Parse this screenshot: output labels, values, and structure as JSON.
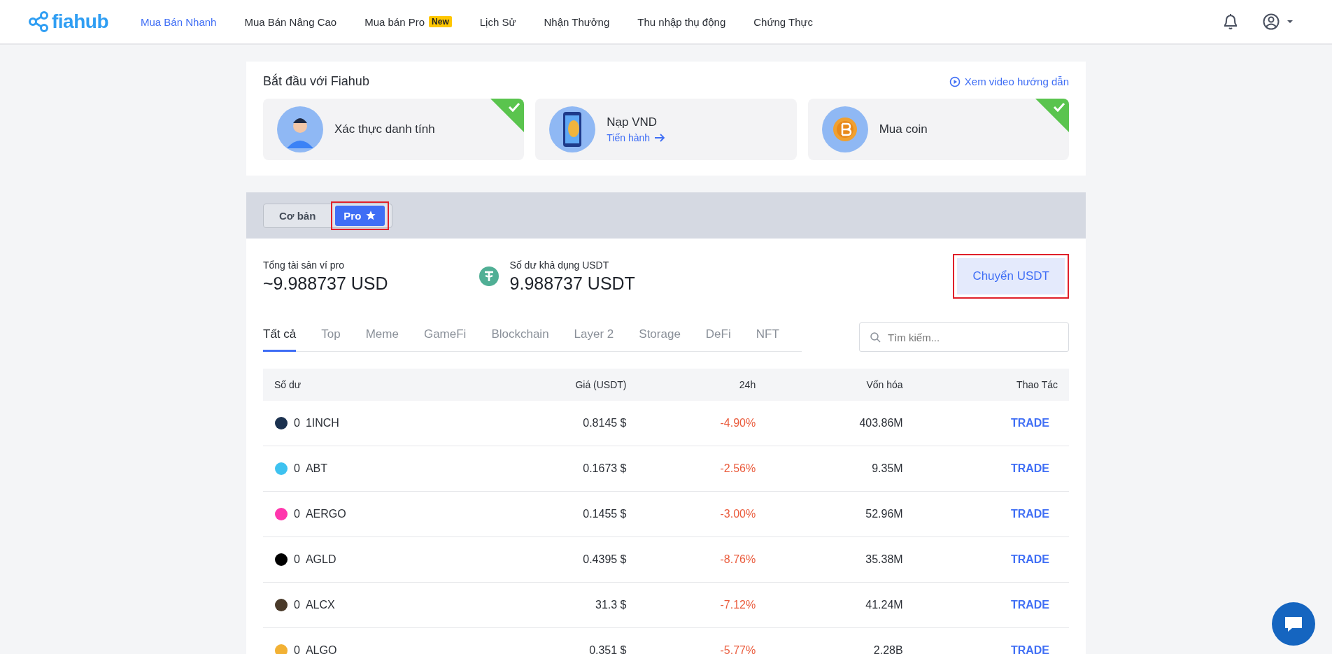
{
  "nav": {
    "logo": "fiahub",
    "items": [
      {
        "label": "Mua Bán Nhanh",
        "selected": true
      },
      {
        "label": "Mua Bán Nâng Cao",
        "selected": false
      },
      {
        "label": "Mua bán Pro",
        "selected": false,
        "badge": "New"
      },
      {
        "label": "Lịch Sử",
        "selected": false
      },
      {
        "label": "Nhận Thưởng",
        "selected": false
      },
      {
        "label": "Thu nhập thụ động",
        "selected": false
      },
      {
        "label": "Chứng Thực",
        "selected": false
      }
    ]
  },
  "onboarding": {
    "title": "Bắt đầu với Fiahub",
    "video_link": "Xem video hướng dẫn",
    "steps": [
      {
        "kind": "identity",
        "label": "Xác thực danh tính",
        "done": true
      },
      {
        "kind": "deposit",
        "label": "Nạp VND",
        "done": false,
        "action": "Tiến hành"
      },
      {
        "kind": "coin",
        "label": "Mua coin",
        "done": true
      }
    ]
  },
  "mode_tabs": [
    {
      "label": "Cơ bản",
      "selected": false,
      "highlighted": false
    },
    {
      "label": "Pro",
      "selected": true,
      "highlighted": true
    }
  ],
  "balances": {
    "total_label": "Tổng tài sản ví pro",
    "total_value": "~9.988737 USD",
    "available_label": "Số dư khả dụng USDT",
    "available_value": "9.988737 USDT",
    "transfer_button": {
      "label": "Chuyển USDT",
      "highlighted": true
    }
  },
  "category_tabs": [
    {
      "label": "Tất cả",
      "selected": true
    },
    {
      "label": "Top",
      "selected": false
    },
    {
      "label": "Meme",
      "selected": false
    },
    {
      "label": "GameFi",
      "selected": false
    },
    {
      "label": "Blockchain",
      "selected": false
    },
    {
      "label": "Layer 2",
      "selected": false
    },
    {
      "label": "Storage",
      "selected": false
    },
    {
      "label": "DeFi",
      "selected": false
    },
    {
      "label": "NFT",
      "selected": false
    }
  ],
  "search": {
    "placeholder": "Tìm kiếm..."
  },
  "table": {
    "columns": [
      "Số dư",
      "Giá (USDT)",
      "24h",
      "Vốn hóa",
      "Thao Tác"
    ],
    "rows": [
      {
        "balance": "0",
        "symbol": "1INCH",
        "color": "#1b314f",
        "price": "0.8145 $",
        "change": "-4.90%",
        "market_cap": "403.86M",
        "action": "TRADE"
      },
      {
        "balance": "0",
        "symbol": "ABT",
        "color": "#3ec2f0",
        "price": "0.1673 $",
        "change": "-2.56%",
        "market_cap": "9.35M",
        "action": "TRADE"
      },
      {
        "balance": "0",
        "symbol": "AERGO",
        "color": "#ff36ad",
        "price": "0.1455 $",
        "change": "-3.00%",
        "market_cap": "52.96M",
        "action": "TRADE"
      },
      {
        "balance": "0",
        "symbol": "AGLD",
        "color": "#000000",
        "price": "0.4395 $",
        "change": "-8.76%",
        "market_cap": "35.38M",
        "action": "TRADE"
      },
      {
        "balance": "0",
        "symbol": "ALCX",
        "color": "#4a3a2a",
        "price": "31.3 $",
        "change": "-7.12%",
        "market_cap": "41.24M",
        "action": "TRADE"
      },
      {
        "balance": "0",
        "symbol": "ALGO",
        "color": "#f2b134",
        "price": "0.351 $",
        "change": "-5.77%",
        "market_cap": "2.28B",
        "action": "TRADE"
      }
    ]
  }
}
